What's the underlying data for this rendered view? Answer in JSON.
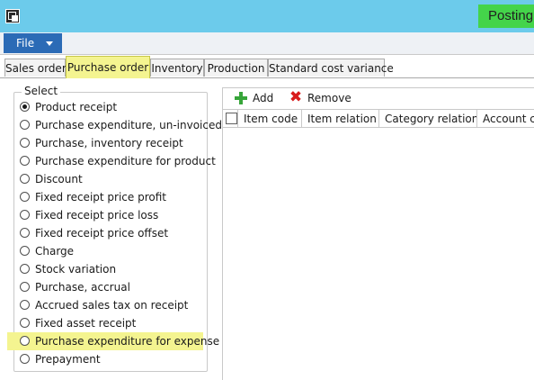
{
  "window": {
    "title": "Posting",
    "app_icon": "app-window-icon"
  },
  "menu": {
    "file_label": "File"
  },
  "tabs": [
    {
      "label": "Sales order",
      "active": false
    },
    {
      "label": "Purchase order",
      "active": true
    },
    {
      "label": "Inventory",
      "active": false
    },
    {
      "label": "Production",
      "active": false
    },
    {
      "label": "Standard cost variance",
      "active": false
    }
  ],
  "select_group": {
    "legend": "Select",
    "options": [
      {
        "label": "Product receipt",
        "checked": true
      },
      {
        "label": "Purchase expenditure, un-invoiced",
        "checked": false
      },
      {
        "label": "Purchase, inventory receipt",
        "checked": false
      },
      {
        "label": "Purchase expenditure for product",
        "checked": false
      },
      {
        "label": "Discount",
        "checked": false
      },
      {
        "label": "Fixed receipt price profit",
        "checked": false
      },
      {
        "label": "Fixed receipt price loss",
        "checked": false
      },
      {
        "label": "Fixed receipt price offset",
        "checked": false
      },
      {
        "label": "Charge",
        "checked": false
      },
      {
        "label": "Stock variation",
        "checked": false
      },
      {
        "label": "Purchase, accrual",
        "checked": false
      },
      {
        "label": "Accrued sales tax on receipt",
        "checked": false
      },
      {
        "label": "Fixed asset receipt",
        "checked": false
      },
      {
        "label": "Purchase expenditure for expense",
        "checked": false,
        "highlighted": true
      },
      {
        "label": "Prepayment",
        "checked": false
      }
    ]
  },
  "toolbar": {
    "add_label": "Add",
    "remove_label": "Remove"
  },
  "grid": {
    "columns": [
      "Item code",
      "Item relation",
      "Category relation",
      "Account co"
    ]
  },
  "colors": {
    "titlebar": "#6ccbeb",
    "highlight": "#f4f490",
    "title_highlight": "#44d44a",
    "file_button": "#2b6bb6"
  }
}
